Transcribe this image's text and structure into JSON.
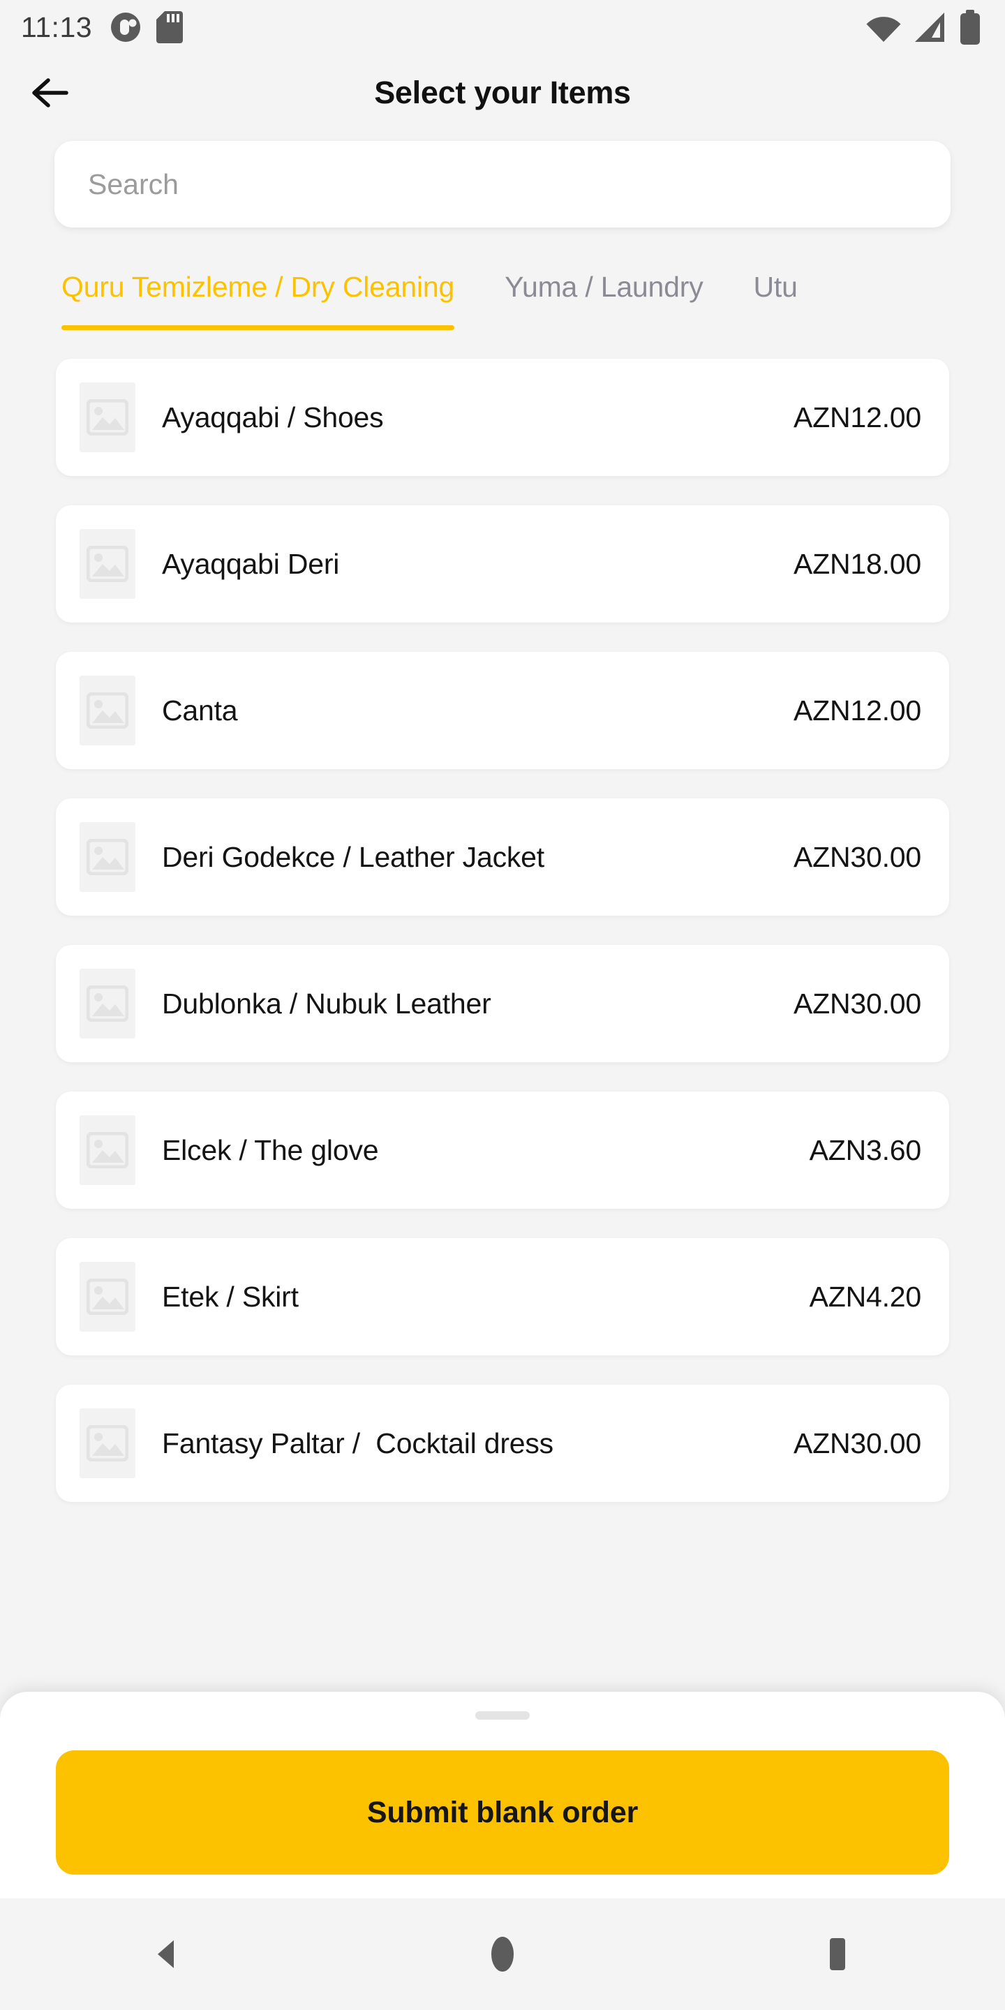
{
  "status_bar": {
    "time": "11:13",
    "left_icons": [
      "app-notification-icon",
      "sd-card-icon"
    ],
    "right_icons": [
      "wifi-icon",
      "cellular-signal-icon",
      "battery-icon"
    ]
  },
  "app_bar": {
    "back_icon": "arrow-left-icon",
    "title": "Select your Items"
  },
  "search": {
    "value": "",
    "placeholder": "Search"
  },
  "tabs": [
    {
      "label": "Quru Temizleme / Dry Cleaning",
      "active": true
    },
    {
      "label": "Yuma / Laundry",
      "active": false
    },
    {
      "label": "Utu",
      "active": false
    }
  ],
  "items": [
    {
      "name": "Ayaqqabi / Shoes",
      "price": "AZN12.00",
      "thumb": "image-placeholder-icon"
    },
    {
      "name": "Ayaqqabi Deri",
      "price": "AZN18.00",
      "thumb": "image-placeholder-icon"
    },
    {
      "name": "Canta",
      "price": "AZN12.00",
      "thumb": "image-placeholder-icon"
    },
    {
      "name": "Deri Godekce / Leather Jacket",
      "price": "AZN30.00",
      "thumb": "image-placeholder-icon"
    },
    {
      "name": "Dublonka / Nubuk Leather",
      "price": "AZN30.00",
      "thumb": "image-placeholder-icon"
    },
    {
      "name": "Elcek / The glove",
      "price": "AZN3.60",
      "thumb": "image-placeholder-icon"
    },
    {
      "name": "Etek / Skirt",
      "price": "AZN4.20",
      "thumb": "image-placeholder-icon"
    },
    {
      "name": "Fantasy Paltar /  Cocktail dress",
      "price": "AZN30.00",
      "thumb": "image-placeholder-icon"
    }
  ],
  "bottom_sheet": {
    "handle": "drag-handle",
    "submit_label": "Submit blank order"
  },
  "nav_bar": {
    "back": "nav-back-triangle-icon",
    "home": "nav-home-circle-icon",
    "recents": "nav-recents-square-icon"
  },
  "colors": {
    "accent": "#FCC200",
    "page_bg": "#F4F4F4",
    "card_bg": "#FFFFFF",
    "text_primary": "#141414",
    "text_muted": "#8B8B96",
    "placeholder": "#9B9B9B"
  }
}
